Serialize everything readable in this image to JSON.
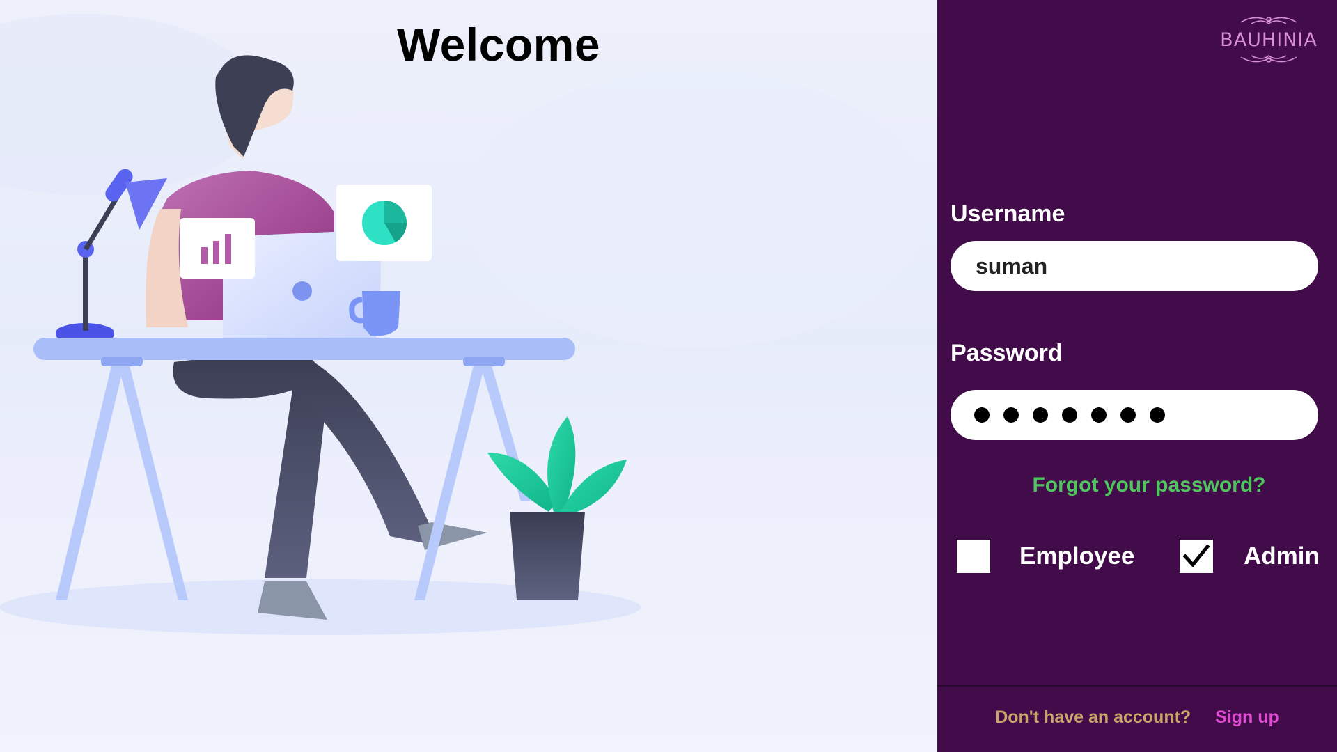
{
  "welcome": {
    "title": "Welcome"
  },
  "brand": {
    "logo_text": "BAUHINIA"
  },
  "login": {
    "username_label": "Username",
    "username_value": "suman",
    "password_label": "Password",
    "password_mask_count": 7,
    "forgot_link": "Forgot your password?"
  },
  "roles": {
    "employee": {
      "label": "Employee",
      "checked": false
    },
    "admin": {
      "label": "Admin",
      "checked": true
    }
  },
  "footer": {
    "prompt": "Don't have an account?",
    "signup_link": "Sign up"
  },
  "colors": {
    "panel_bg": "#420b4a",
    "forgot_link": "#4ec65d",
    "signup_link": "#e04ad2",
    "footer_prompt": "#c9a56b",
    "logo": "#d88fd7"
  }
}
